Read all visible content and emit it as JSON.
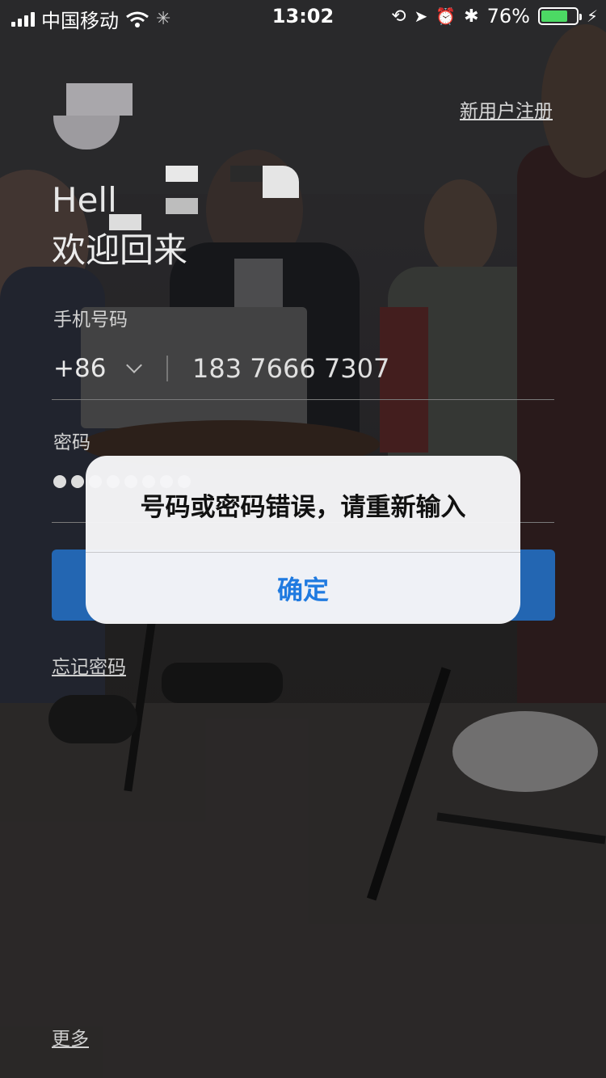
{
  "status_bar": {
    "carrier": "中国移动",
    "time": "13:02",
    "battery_percent": "76%",
    "battery_level": 0.76,
    "icons": [
      "signal-icon",
      "wifi-icon",
      "loading-icon",
      "rotation-lock-icon",
      "location-icon",
      "alarm-icon",
      "bluetooth-icon",
      "battery-icon",
      "charging-icon"
    ]
  },
  "login": {
    "register_link": "新用户注册",
    "greeting": "Hell",
    "welcome": "欢迎回来",
    "phone_label": "手机号码",
    "country_code": "+86",
    "phone_value": "183 7666 7307",
    "password_label": "密码",
    "forgot_password": "忘记密码",
    "more": "更多"
  },
  "alert": {
    "message": "号码或密码错误，请重新输入",
    "confirm": "确定"
  },
  "colors": {
    "primary_button": "#2366b2",
    "alert_action": "#1f7ae0",
    "battery_fill": "#4cd964"
  }
}
